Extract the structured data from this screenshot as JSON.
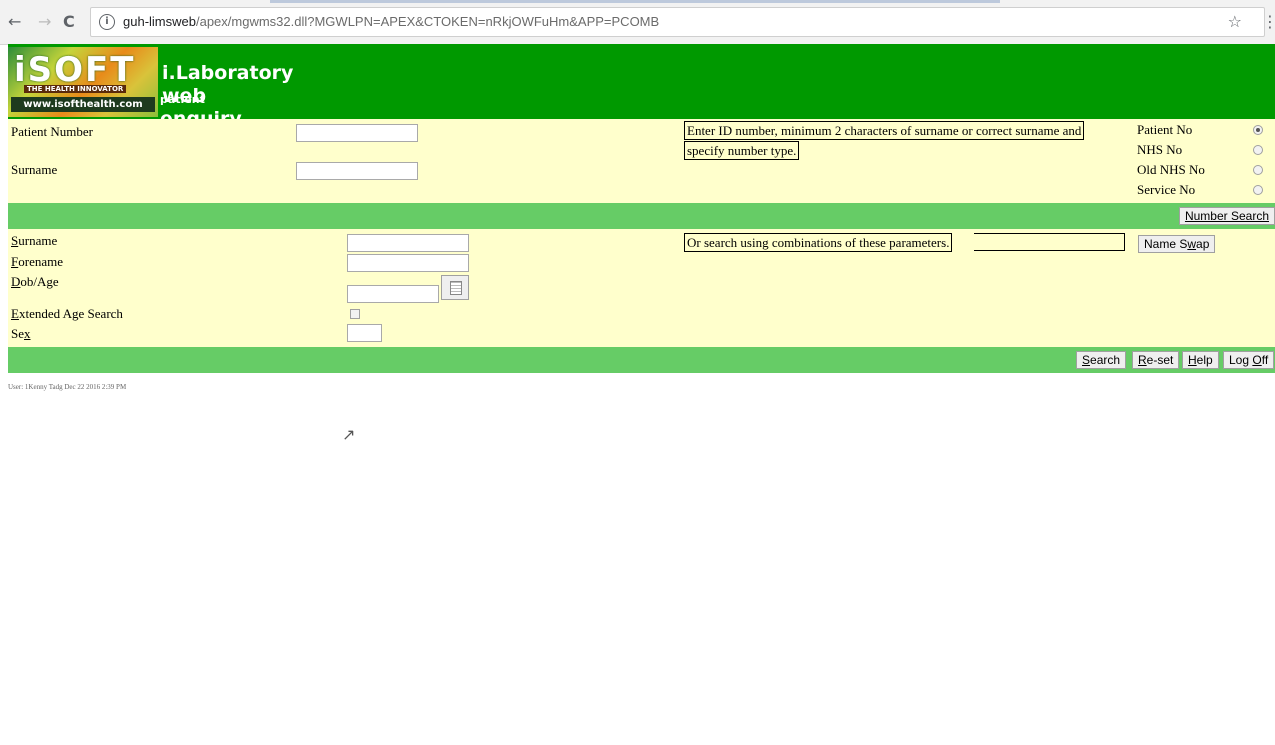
{
  "browser": {
    "url_host": "guh-limsweb",
    "url_path": "/apex/mgwms32.dll?MGWLPN=APEX&CTOKEN=nRkjOWFuHm&APP=PCOMB",
    "back_glyph": "←",
    "forward_glyph": "→",
    "reload_glyph": "C",
    "info_glyph": "i",
    "star_glyph": "☆",
    "menu_glyph": "⋮"
  },
  "header": {
    "logo_word": "iSOFT",
    "logo_tagline": "THE HEALTH INNOVATOR",
    "logo_site": "www.isofthealth.com",
    "app_title": "i.Laboratory web",
    "app_subtitle": "patient",
    "app_subtitle2": "enquiry",
    "bg_color": "#009900"
  },
  "number_search": {
    "patient_number_label": "Patient Number",
    "surname_label": "Surname",
    "patient_number_value": "",
    "surname_value": "",
    "hint_line1": "Enter ID number, minimum 2 characters of surname or correct surname and",
    "hint_line2": "specify number type.",
    "number_types": [
      {
        "label": "Patient No",
        "selected": true
      },
      {
        "label": "NHS No",
        "selected": false
      },
      {
        "label": "Old NHS No",
        "selected": false
      },
      {
        "label": "Service No",
        "selected": false
      }
    ],
    "button_label": "Number Search"
  },
  "name_search": {
    "surname_label_u": "S",
    "surname_label_rest": "urname",
    "forename_label_u": "F",
    "forename_label_rest": "orename",
    "dob_label_u": "D",
    "dob_label_rest": "ob/Age",
    "extended_label_u": "E",
    "extended_label_rest": "xtended Age Search",
    "sex_label_pre": "Se",
    "sex_label_u": "x",
    "hint": "Or search using combinations of these parameters.",
    "name_swap_pre": "Name S",
    "name_swap_u": "w",
    "name_swap_post": "ap"
  },
  "actions": {
    "search_u": "S",
    "search_rest": "earch",
    "reset_u": "R",
    "reset_rest": "e-set",
    "help_u": "H",
    "help_rest": "elp",
    "logoff_pre": "Log ",
    "logoff_u": "O",
    "logoff_post": "ff"
  },
  "footer": {
    "user_line": "User: 1Kenny Tadg Dec 22 2016 2:39 PM"
  },
  "colors": {
    "pane": "#ffffcc",
    "bar": "#66cc66",
    "header": "#009900"
  }
}
